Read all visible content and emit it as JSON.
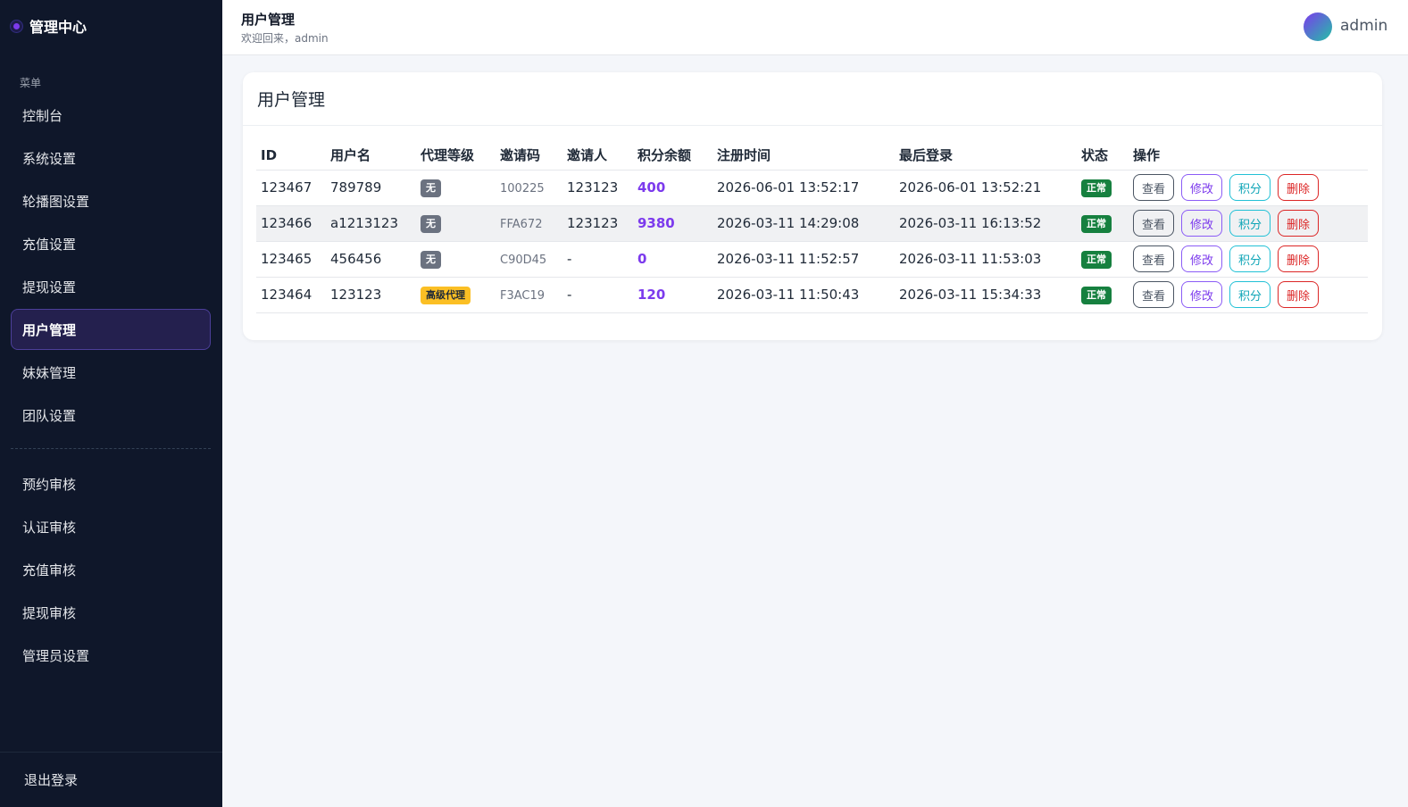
{
  "sidebar": {
    "brand": "管理中心",
    "caption": "菜单",
    "items_top": [
      {
        "label": "控制台",
        "name": "sidebar-item-dashboard"
      },
      {
        "label": "系统设置",
        "name": "sidebar-item-system-settings"
      },
      {
        "label": "轮播图设置",
        "name": "sidebar-item-carousel-settings"
      },
      {
        "label": "充值设置",
        "name": "sidebar-item-recharge-settings"
      },
      {
        "label": "提现设置",
        "name": "sidebar-item-withdraw-settings"
      },
      {
        "label": "用户管理",
        "name": "sidebar-item-user-management"
      },
      {
        "label": "妹妹管理",
        "name": "sidebar-item-sister-management"
      },
      {
        "label": "团队设置",
        "name": "sidebar-item-team-settings"
      }
    ],
    "items_bottom": [
      {
        "label": "预约审核",
        "name": "sidebar-item-booking-review"
      },
      {
        "label": "认证审核",
        "name": "sidebar-item-verification-review"
      },
      {
        "label": "充值审核",
        "name": "sidebar-item-recharge-review"
      },
      {
        "label": "提现审核",
        "name": "sidebar-item-withdraw-review"
      },
      {
        "label": "管理员设置",
        "name": "sidebar-item-admin-settings"
      }
    ],
    "active_index": 5,
    "logout": "退出登录"
  },
  "header": {
    "title": "用户管理",
    "subtitle": "欢迎回来，admin",
    "username": "admin"
  },
  "card": {
    "title": "用户管理",
    "columns": [
      "ID",
      "用户名",
      "代理等级",
      "邀请码",
      "邀请人",
      "积分余额",
      "注册时间",
      "最后登录",
      "状态",
      "操作"
    ],
    "rows": [
      {
        "id": "123467",
        "username": "789789",
        "level": "无",
        "level_type": "none",
        "invite_code": "100225",
        "inviter": "123123",
        "points": "400",
        "registered": "2026-06-01 13:52:17",
        "last_login": "2026-06-01 13:52:21",
        "status": "正常"
      },
      {
        "id": "123466",
        "username": "a1213123",
        "level": "无",
        "level_type": "none",
        "invite_code": "FFA672",
        "inviter": "123123",
        "points": "9380",
        "registered": "2026-03-11 14:29:08",
        "last_login": "2026-03-11 16:13:52",
        "status": "正常"
      },
      {
        "id": "123465",
        "username": "456456",
        "level": "无",
        "level_type": "none",
        "invite_code": "C90D45",
        "inviter": "-",
        "points": "0",
        "registered": "2026-03-11 11:52:57",
        "last_login": "2026-03-11 11:53:03",
        "status": "正常"
      },
      {
        "id": "123464",
        "username": "123123",
        "level": "高级代理",
        "level_type": "agent",
        "invite_code": "F3AC19",
        "inviter": "-",
        "points": "120",
        "registered": "2026-03-11 11:50:43",
        "last_login": "2026-03-11 15:34:33",
        "status": "正常"
      }
    ],
    "actions": {
      "view": "查看",
      "edit": "修改",
      "points": "积分",
      "delete": "删除"
    }
  },
  "colors": {
    "sidebar_bg": "#0f172a",
    "active_bg": "#24204e",
    "accent": "#7c3aed",
    "status_ok": "#16803f",
    "agent_badge": "#fbbf24",
    "danger": "#dc2626"
  }
}
